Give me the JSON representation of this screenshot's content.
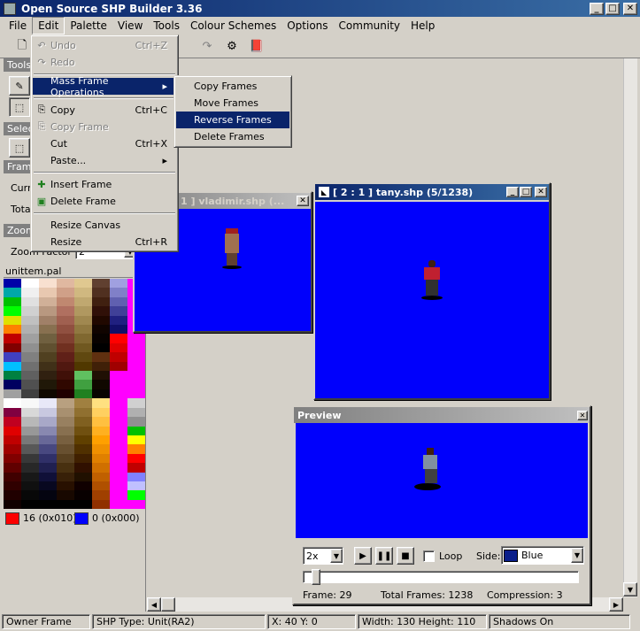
{
  "app": {
    "title": "Open Source SHP Builder 3.36"
  },
  "menubar": [
    "File",
    "Edit",
    "Palette",
    "View",
    "Tools",
    "Colour Schemes",
    "Options",
    "Community",
    "Help"
  ],
  "left_panel": {
    "tools_label": "Tools",
    "select_label": "Selec",
    "frame_label": "Frame",
    "curr_label": "Curr",
    "total_label": "Tota",
    "zoom_label": "Zoom",
    "zoom_factor_label": "Zoom Factor",
    "zoom_value": "2",
    "palette_name": "unittem.pal",
    "left_color": "16 (0x010)",
    "right_color": "0 (0x000)",
    "left_color_hex": "#fc0000",
    "right_color_hex": "#0000fc"
  },
  "edit_menu": {
    "undo": "Undo",
    "undo_sc": "Ctrl+Z",
    "redo": "Redo",
    "mass": "Mass Frame Operations",
    "copy": "Copy",
    "copy_sc": "Ctrl+C",
    "copy_frame": "Copy Frame",
    "cut": "Cut",
    "cut_sc": "Ctrl+X",
    "paste": "Paste...",
    "insert_frame": "Insert Frame",
    "delete_frame": "Delete Frame",
    "resize_canvas": "Resize Canvas",
    "resize": "Resize",
    "resize_sc": "Ctrl+R"
  },
  "mass_submenu": {
    "copy_frames": "Copy Frames",
    "move_frames": "Move Frames",
    "reverse_frames": "Reverse Frames",
    "delete_frames": "Delete Frames"
  },
  "windows": {
    "vladimir_title": "1 ] vladimir.shp (...",
    "tany_title": "[ 2 : 1 ] tany.shp (5/1238)"
  },
  "preview": {
    "title": "Preview",
    "zoom": "2x",
    "loop": "Loop",
    "side_label": "Side:",
    "side_value": "Blue",
    "frame": "Frame: 29",
    "total_frames": "Total Frames: 1238",
    "compression": "Compression: 3"
  },
  "statusbar": {
    "owner": "Owner Frame",
    "shp_type": "SHP Type: Unit(RA2)",
    "coords": "X: 40 Y: 0",
    "size": "Width: 130 Height: 110",
    "shadows": "Shadows On"
  }
}
